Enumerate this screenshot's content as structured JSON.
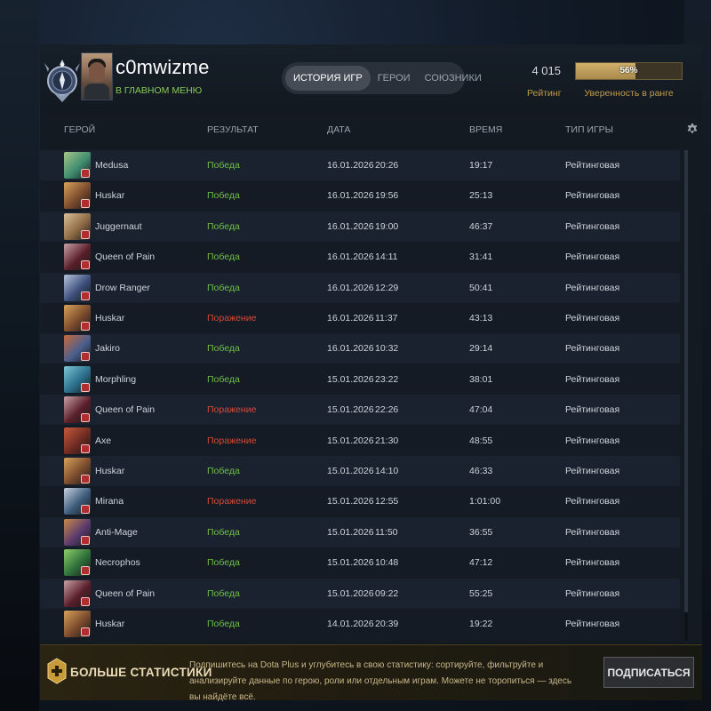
{
  "header": {
    "username": "c0mwizme",
    "status": "В ГЛАВНОМ МЕНЮ",
    "tabs": [
      {
        "label": "ИСТОРИЯ ИГР",
        "active": true
      },
      {
        "label": "ГЕРОИ",
        "active": false
      },
      {
        "label": "СОЮЗНИКИ",
        "active": false
      }
    ],
    "rating_value": "4 015",
    "rating_label": "Рейтинг",
    "confidence_percent": 56,
    "confidence_text": "56%",
    "confidence_label": "Уверенность в ранге"
  },
  "columns": {
    "hero": "ГЕРОЙ",
    "result": "РЕЗУЛЬТАТ",
    "date": "ДАТА",
    "time": "ВРЕМЯ",
    "type": "ТИП ИГРЫ"
  },
  "matches": [
    {
      "hero": "Medusa",
      "result": "Победа",
      "win": true,
      "date": "16.01.2026",
      "clock": "20:26",
      "duration": "19:17",
      "type": "Рейтинговая",
      "color1": "#3e8c70",
      "color2": "#a7c889"
    },
    {
      "hero": "Huskar",
      "result": "Победа",
      "win": true,
      "date": "16.01.2026",
      "clock": "19:56",
      "duration": "25:13",
      "type": "Рейтинговая",
      "color1": "#7a4a2c",
      "color2": "#d9a25a"
    },
    {
      "hero": "Juggernaut",
      "result": "Победа",
      "win": true,
      "date": "16.01.2026",
      "clock": "19:00",
      "duration": "46:37",
      "type": "Рейтинговая",
      "color1": "#8e6a44",
      "color2": "#dcc198"
    },
    {
      "hero": "Queen of Pain",
      "result": "Победа",
      "win": true,
      "date": "16.01.2026",
      "clock": "14:11",
      "duration": "31:41",
      "type": "Рейтинговая",
      "color1": "#5a1f2a",
      "color2": "#c9a2a6"
    },
    {
      "hero": "Drow Ranger",
      "result": "Победа",
      "win": true,
      "date": "16.01.2026",
      "clock": "12:29",
      "duration": "50:41",
      "type": "Рейтинговая",
      "color1": "#3b4f7a",
      "color2": "#b7c4dc"
    },
    {
      "hero": "Huskar",
      "result": "Поражение",
      "win": false,
      "date": "16.01.2026",
      "clock": "11:37",
      "duration": "43:13",
      "type": "Рейтинговая",
      "color1": "#7a4a2c",
      "color2": "#d9a25a"
    },
    {
      "hero": "Jakiro",
      "result": "Победа",
      "win": true,
      "date": "16.01.2026",
      "clock": "10:32",
      "duration": "29:14",
      "type": "Рейтинговая",
      "color1": "#4a5f8e",
      "color2": "#c96a3a"
    },
    {
      "hero": "Morphling",
      "result": "Победа",
      "win": true,
      "date": "15.01.2026",
      "clock": "23:22",
      "duration": "38:01",
      "type": "Рейтинговая",
      "color1": "#2b6e8c",
      "color2": "#7ec6d6"
    },
    {
      "hero": "Queen of Pain",
      "result": "Поражение",
      "win": false,
      "date": "15.01.2026",
      "clock": "22:26",
      "duration": "47:04",
      "type": "Рейтинговая",
      "color1": "#5a1f2a",
      "color2": "#c9a2a6"
    },
    {
      "hero": "Axe",
      "result": "Поражение",
      "win": false,
      "date": "15.01.2026",
      "clock": "21:30",
      "duration": "48:55",
      "type": "Рейтинговая",
      "color1": "#6e2a22",
      "color2": "#c75a3a"
    },
    {
      "hero": "Huskar",
      "result": "Победа",
      "win": true,
      "date": "15.01.2026",
      "clock": "14:10",
      "duration": "46:33",
      "type": "Рейтинговая",
      "color1": "#7a4a2c",
      "color2": "#d9a25a"
    },
    {
      "hero": "Mirana",
      "result": "Поражение",
      "win": false,
      "date": "15.01.2026",
      "clock": "12:55",
      "duration": "1:01:00",
      "type": "Рейтинговая",
      "color1": "#3c5a7a",
      "color2": "#c8d2e0"
    },
    {
      "hero": "Anti-Mage",
      "result": "Победа",
      "win": true,
      "date": "15.01.2026",
      "clock": "11:50",
      "duration": "36:55",
      "type": "Рейтинговая",
      "color1": "#5a3a6e",
      "color2": "#c98a4a"
    },
    {
      "hero": "Necrophos",
      "result": "Победа",
      "win": true,
      "date": "15.01.2026",
      "clock": "10:48",
      "duration": "47:12",
      "type": "Рейтинговая",
      "color1": "#2e6e3a",
      "color2": "#8ed06a"
    },
    {
      "hero": "Queen of Pain",
      "result": "Победа",
      "win": true,
      "date": "15.01.2026",
      "clock": "09:22",
      "duration": "55:25",
      "type": "Рейтинговая",
      "color1": "#5a1f2a",
      "color2": "#c9a2a6"
    },
    {
      "hero": "Huskar",
      "result": "Победа",
      "win": true,
      "date": "14.01.2026",
      "clock": "20:39",
      "duration": "19:22",
      "type": "Рейтинговая",
      "color1": "#7a4a2c",
      "color2": "#d9a25a"
    }
  ],
  "promo": {
    "title": "БОЛЬШЕ СТАТИСТИКИ",
    "text": "Подпишитесь на Dota Plus и углубитесь в свою статистику: сортируйте, фильтруйте и анализируйте данные по герою, роли или отдельным играм. Можете не торопиться — здесь вы найдёте всё.",
    "button": "ПОДПИСАТЬСЯ"
  },
  "colors": {
    "win": "#6fbf49",
    "loss": "#d64a38",
    "gold": "#c29a4c",
    "status_green": "#88c95a"
  },
  "icons": {
    "rank": "rank-medal-icon",
    "settings": "gear-icon",
    "plus": "dota-plus-icon"
  }
}
